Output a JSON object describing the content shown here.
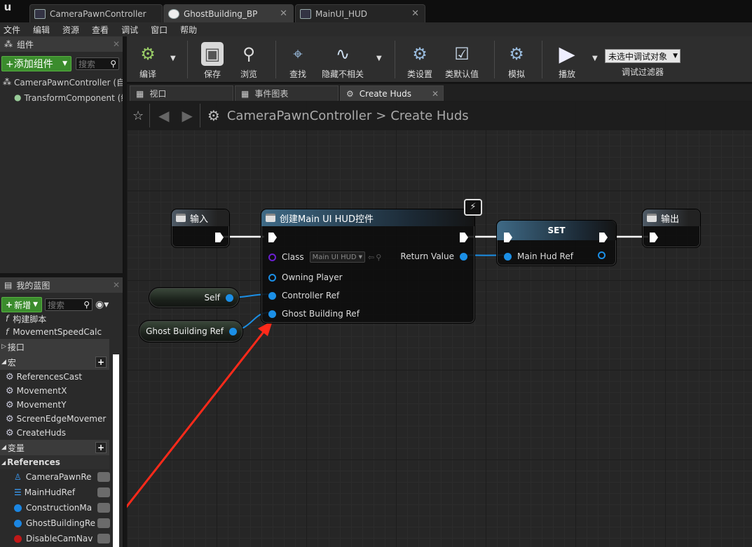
{
  "doc_tabs": [
    {
      "label": "CameraPawnController"
    },
    {
      "label": "GhostBuilding_BP"
    },
    {
      "label": "MainUI_HUD"
    }
  ],
  "menu": [
    "文件",
    "编辑",
    "资源",
    "查看",
    "调试",
    "窗口",
    "帮助"
  ],
  "components_panel": {
    "title": "组件",
    "add_label": "+添加组件",
    "search_placeholder": "搜索",
    "items": [
      "CameraPawnController (自",
      "TransformComponent (继"
    ]
  },
  "mybp_panel": {
    "title": "我的蓝图",
    "new_label": "新增",
    "search_placeholder": "搜索",
    "partial_items": [
      "构建脚本",
      "MovementSpeedCalc"
    ],
    "interface_label": "接口",
    "macro_label": "宏",
    "macros": [
      "ReferencesCast",
      "MovementX",
      "MovementY",
      "ScreenEdgeMovemer",
      "CreateHuds"
    ],
    "vars_label": "变量",
    "references_label": "References",
    "variables": [
      "CameraPawnRe",
      "MainHudRef",
      "ConstructionMa",
      "GhostBuildingRe",
      "DisableCamNav"
    ]
  },
  "toolbar": {
    "compile": "编译",
    "save": "保存",
    "browse": "浏览",
    "find": "查找",
    "hide_unrelated": "隐藏不相关",
    "class_settings": "类设置",
    "class_defaults": "类默认值",
    "simulate": "模拟",
    "play": "播放",
    "debug_select": "未选中调试对象",
    "debug_filter": "调试过滤器"
  },
  "graph_tabs": [
    {
      "label": "视口"
    },
    {
      "label": "事件图表"
    },
    {
      "label": "Create Huds"
    }
  ],
  "breadcrumb": {
    "class": "CameraPawnController",
    "separator": ">",
    "function": "Create Huds"
  },
  "nodes": {
    "input": {
      "title": "输入"
    },
    "create": {
      "title": "创建Main UI HUD控件",
      "class_label": "Class",
      "class_value": "Main UI HUD",
      "return_label": "Return Value",
      "owning_player": "Owning Player",
      "controller_ref": "Controller Ref",
      "ghost_building_ref": "Ghost Building Ref"
    },
    "set": {
      "title": "SET",
      "var_label": "Main Hud Ref"
    },
    "output": {
      "title": "输出"
    },
    "self": {
      "label": "Self"
    },
    "ghost": {
      "label": "Ghost Building Ref"
    }
  },
  "colors": {
    "accent_green": "#3b8c2d",
    "pin_blue": "#1b8fe6",
    "arrow_red": "#ff2a1a"
  }
}
